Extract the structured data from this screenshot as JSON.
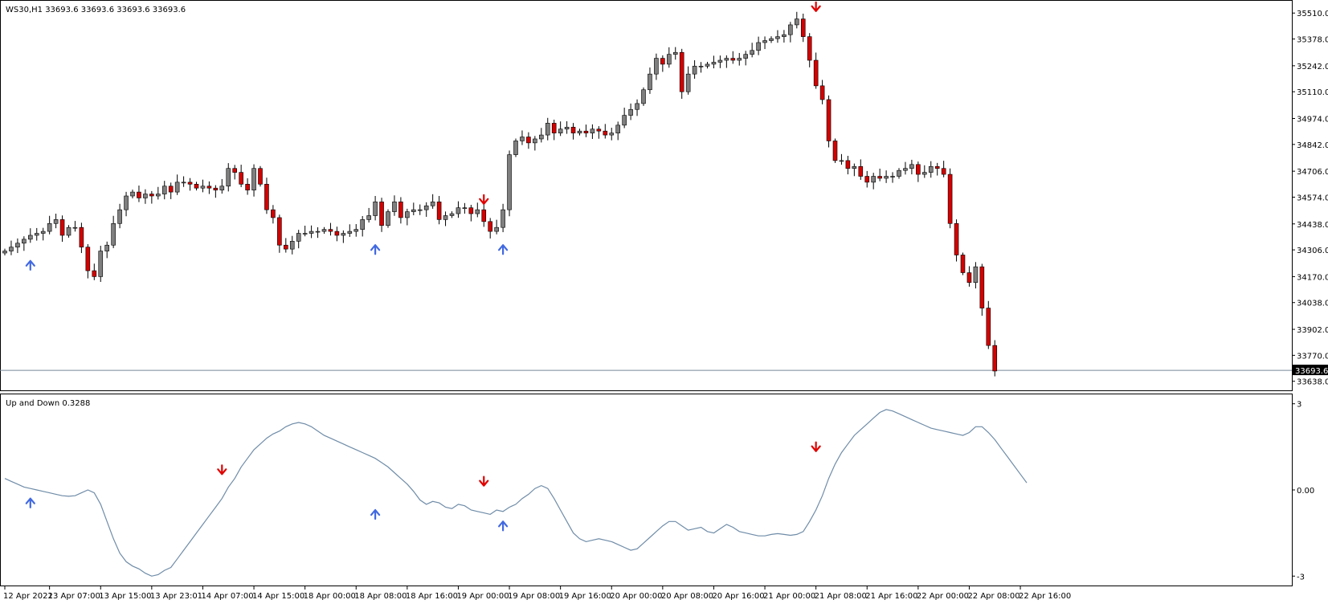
{
  "window": {
    "main_label": "WS30,H1  33693.6 33693.6 33693.6 33693.6",
    "indicator_label": "Up and Down 0.3288"
  },
  "colors": {
    "bull": "#7f7f7f",
    "bear": "#d40000",
    "wick": "#000000",
    "up_arrow": "#4169e1",
    "down_arrow": "#e00000",
    "indicator_line": "#6f8ca8",
    "price_line": "#778899",
    "frame": "#000000"
  },
  "chart_data": [
    {
      "type": "candlestick",
      "symbol": "WS30",
      "timeframe": "H1",
      "ylim": [
        33600,
        35560
      ],
      "y_ticks": [
        "35510.0",
        "35378.0",
        "35242.0",
        "35110.0",
        "34974.0",
        "34842.0",
        "34706.0",
        "34574.0",
        "34438.0",
        "34306.0",
        "34170.0",
        "34038.0",
        "33902.0",
        "33770.0",
        "33638.0"
      ],
      "current_price": "33693.6",
      "x_ticks": [
        "12 Apr 2022",
        "13 Apr 07:00",
        "13 Apr 15:00",
        "13 Apr 23:01",
        "14 Apr 07:00",
        "14 Apr 15:00",
        "18 Apr 00:00",
        "18 Apr 08:00",
        "18 Apr 16:00",
        "19 Apr 00:00",
        "19 Apr 08:00",
        "19 Apr 16:00",
        "20 Apr 00:00",
        "20 Apr 08:00",
        "20 Apr 16:00",
        "21 Apr 00:00",
        "21 Apr 08:00",
        "21 Apr 16:00",
        "22 Apr 00:00",
        "22 Apr 08:00",
        "22 Apr 16:00"
      ],
      "close": [
        34300,
        34320,
        34340,
        34360,
        34380,
        34390,
        34400,
        34440,
        34460,
        34380,
        34420,
        34420,
        34320,
        34200,
        34170,
        34300,
        34330,
        34440,
        34510,
        34580,
        34600,
        34570,
        34590,
        34580,
        34590,
        34630,
        34600,
        34650,
        34650,
        34640,
        34620,
        34630,
        34620,
        34610,
        34630,
        34720,
        34700,
        34640,
        34610,
        34720,
        34640,
        34510,
        34470,
        34330,
        34310,
        34350,
        34390,
        34390,
        34400,
        34400,
        34410,
        34400,
        34380,
        34390,
        34400,
        34410,
        34460,
        34480,
        34550,
        34430,
        34500,
        34550,
        34470,
        34500,
        34510,
        34510,
        34530,
        34550,
        34460,
        34480,
        34490,
        34520,
        34520,
        34490,
        34510,
        34450,
        34400,
        34420,
        34510,
        34790,
        34860,
        34880,
        34850,
        34870,
        34890,
        34950,
        34900,
        34920,
        34930,
        34900,
        34910,
        34900,
        34920,
        34910,
        34890,
        34900,
        34940,
        34990,
        35020,
        35050,
        35120,
        35200,
        35280,
        35250,
        35300,
        35310,
        35110,
        35200,
        35240,
        35240,
        35250,
        35260,
        35270,
        35280,
        35270,
        35280,
        35300,
        35320,
        35360,
        35370,
        35380,
        35390,
        35400,
        35450,
        35480,
        35390,
        35270,
        35140,
        35070,
        34860,
        34760,
        34760,
        34720,
        34730,
        34680,
        34650,
        34680,
        34670,
        34680,
        34680,
        34710,
        34720,
        34740,
        34690,
        34700,
        34730,
        34720,
        34690,
        34440,
        34280,
        34190,
        34140,
        34220,
        34010,
        33820,
        33690
      ],
      "hl_spread": 30,
      "bar_index_of_ticks": [
        0,
        7,
        15,
        23,
        31,
        39,
        47,
        55,
        63,
        71,
        79,
        87,
        95,
        103,
        111,
        119,
        127,
        135,
        143,
        151,
        159
      ],
      "arrows": [
        {
          "dir": "up",
          "bar": 4,
          "price": 34250
        },
        {
          "dir": "up",
          "bar": 58,
          "price": 34330
        },
        {
          "dir": "down",
          "bar": 75,
          "price": 34540
        },
        {
          "dir": "up",
          "bar": 78,
          "price": 34330
        },
        {
          "dir": "down",
          "bar": 127,
          "price": 35520
        }
      ]
    },
    {
      "type": "line",
      "name": "Up and Down",
      "value": "0.3288",
      "ylim": [
        -3.3,
        3.3
      ],
      "y_ticks": [
        "3",
        "0.00",
        "-3"
      ],
      "values": [
        0.4,
        0.3,
        0.2,
        0.1,
        0.05,
        0.0,
        -0.05,
        -0.1,
        -0.15,
        -0.2,
        -0.22,
        -0.2,
        -0.1,
        0.0,
        -0.1,
        -0.5,
        -1.1,
        -1.7,
        -2.2,
        -2.5,
        -2.65,
        -2.75,
        -2.9,
        -3.0,
        -2.95,
        -2.8,
        -2.7,
        -2.4,
        -2.1,
        -1.8,
        -1.5,
        -1.2,
        -0.9,
        -0.6,
        -0.3,
        0.1,
        0.4,
        0.8,
        1.1,
        1.4,
        1.6,
        1.8,
        1.95,
        2.05,
        2.2,
        2.3,
        2.35,
        2.3,
        2.2,
        2.05,
        1.9,
        1.8,
        1.7,
        1.6,
        1.5,
        1.4,
        1.3,
        1.2,
        1.1,
        0.95,
        0.8,
        0.6,
        0.4,
        0.2,
        -0.05,
        -0.35,
        -0.5,
        -0.4,
        -0.45,
        -0.6,
        -0.65,
        -0.5,
        -0.55,
        -0.7,
        -0.75,
        -0.8,
        -0.85,
        -0.7,
        -0.75,
        -0.6,
        -0.5,
        -0.3,
        -0.15,
        0.05,
        0.15,
        0.05,
        -0.3,
        -0.7,
        -1.1,
        -1.5,
        -1.7,
        -1.8,
        -1.75,
        -1.7,
        -1.75,
        -1.8,
        -1.9,
        -2.0,
        -2.1,
        -2.05,
        -1.85,
        -1.65,
        -1.45,
        -1.25,
        -1.1,
        -1.1,
        -1.25,
        -1.4,
        -1.35,
        -1.3,
        -1.45,
        -1.5,
        -1.35,
        -1.2,
        -1.3,
        -1.45,
        -1.5,
        -1.55,
        -1.6,
        -1.6,
        -1.55,
        -1.52,
        -1.55,
        -1.58,
        -1.55,
        -1.45,
        -1.1,
        -0.7,
        -0.2,
        0.4,
        0.9,
        1.3,
        1.6,
        1.9,
        2.1,
        2.3,
        2.5,
        2.7,
        2.8,
        2.75,
        2.65,
        2.55,
        2.45,
        2.35,
        2.25,
        2.15,
        2.1,
        2.05,
        2.0,
        1.95,
        1.9,
        2.0,
        2.2,
        2.2,
        2.0,
        1.75,
        1.45,
        1.15,
        0.85,
        0.55,
        0.25
      ],
      "arrows": [
        {
          "dir": "up",
          "bar": 4,
          "value": -0.3
        },
        {
          "dir": "down",
          "bar": 34,
          "value": 0.55
        },
        {
          "dir": "up",
          "bar": 58,
          "value": -0.7
        },
        {
          "dir": "down",
          "bar": 75,
          "value": 0.15
        },
        {
          "dir": "up",
          "bar": 78,
          "value": -1.1
        },
        {
          "dir": "down",
          "bar": 127,
          "value": 1.35
        }
      ]
    }
  ]
}
